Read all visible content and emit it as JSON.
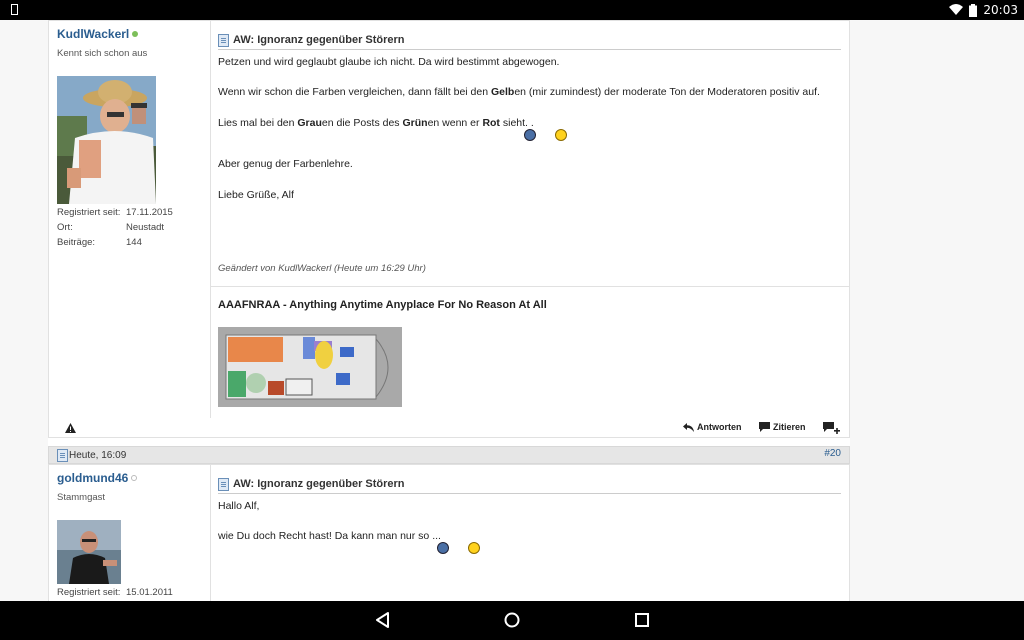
{
  "status_bar": {
    "time": "20:03"
  },
  "post1": {
    "username": "KudlWackerl",
    "user_title": "Kennt sich schon aus",
    "meta": [
      {
        "label": "Registriert seit:",
        "value": "17.11.2015"
      },
      {
        "label": "Ort:",
        "value": "Neustadt"
      },
      {
        "label": "Beiträge:",
        "value": "144"
      }
    ],
    "title": "AW: Ignoranz gegenüber Störern",
    "line1": "Petzen und wird geglaubt glaube ich nicht. Da wird bestimmt abgewogen.",
    "line2_a": "Wenn wir schon die Farben vergleichen, dann fällt bei den ",
    "line2_b": "Gelb",
    "line2_c": "en (mir zumindest) der moderate Ton der Moderatoren positiv auf.",
    "line3_a": "Lies mal bei den ",
    "line3_b": "Grau",
    "line3_c": "en die Posts des ",
    "line3_d": "Grün",
    "line3_e": "en wenn er ",
    "line3_f": "Rot",
    "line3_g": " sieht. .",
    "line4": "Aber genug der Farbenlehre.",
    "line5": "Liebe Grüße, Alf",
    "edited": "Geändert von KudlWackerl (Heute um 16:29 Uhr)",
    "signature": "AAAFNRAA - Anything Anytime Anyplace For No Reason At All"
  },
  "post_actions": {
    "reply": "Antworten",
    "quote": "Zitieren"
  },
  "post2": {
    "date": "Heute, 16:09",
    "number": "#20",
    "username": "goldmund46",
    "user_title": "Stammgast",
    "meta": [
      {
        "label": "Registriert seit:",
        "value": "15.01.2011"
      }
    ],
    "title": "AW: Ignoranz gegenüber Störern",
    "line1": "Hallo Alf,",
    "line2": "wie Du doch Recht hast! Da kann man nur so ..."
  },
  "colors": {
    "username": "#2a5d8f",
    "online": "#7dbf5a",
    "offline": "#bbbbbb"
  }
}
